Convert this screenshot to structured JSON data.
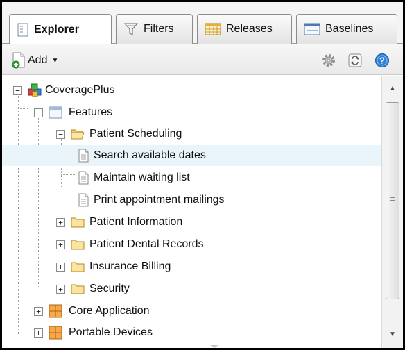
{
  "tabs": [
    {
      "label": "Explorer",
      "icon": "explorer-icon",
      "active": true
    },
    {
      "label": "Filters",
      "icon": "filter-funnel-icon",
      "active": false
    },
    {
      "label": "Releases",
      "icon": "releases-icon",
      "active": false
    },
    {
      "label": "Baselines",
      "icon": "baselines-icon",
      "active": false
    }
  ],
  "toolbar": {
    "add_label": "Add",
    "icons": [
      "settings-gear-icon",
      "refresh-icon",
      "help-icon"
    ]
  },
  "tree": {
    "root": {
      "label": "CoveragePlus",
      "icon": "project-cubes-icon",
      "expanded": true
    },
    "features": {
      "label": "Features",
      "icon": "features-icon",
      "expanded": true
    },
    "patient_scheduling": {
      "label": "Patient Scheduling",
      "icon": "folder-open-icon",
      "expanded": true
    },
    "requirements": [
      {
        "label": "Search available dates",
        "icon": "document-icon",
        "selected": true
      },
      {
        "label": "Maintain waiting list",
        "icon": "document-icon",
        "selected": false
      },
      {
        "label": "Print appointment mailings",
        "icon": "document-icon",
        "selected": false
      }
    ],
    "folders": [
      {
        "label": "Patient Information",
        "icon": "folder-icon",
        "expanded": false
      },
      {
        "label": "Patient Dental Records",
        "icon": "folder-icon",
        "expanded": false
      },
      {
        "label": "Insurance Billing",
        "icon": "folder-icon",
        "expanded": false
      },
      {
        "label": "Security",
        "icon": "folder-icon",
        "expanded": false
      }
    ],
    "modules": [
      {
        "label": "Core Application",
        "icon": "module-grid-icon",
        "expanded": false
      },
      {
        "label": "Portable Devices",
        "icon": "module-grid-icon",
        "expanded": false
      }
    ]
  },
  "colors": {
    "selection": "#e9f4fb",
    "folder": "#f7d98a",
    "module": "#f0a040",
    "help": "#2d7fd6"
  }
}
